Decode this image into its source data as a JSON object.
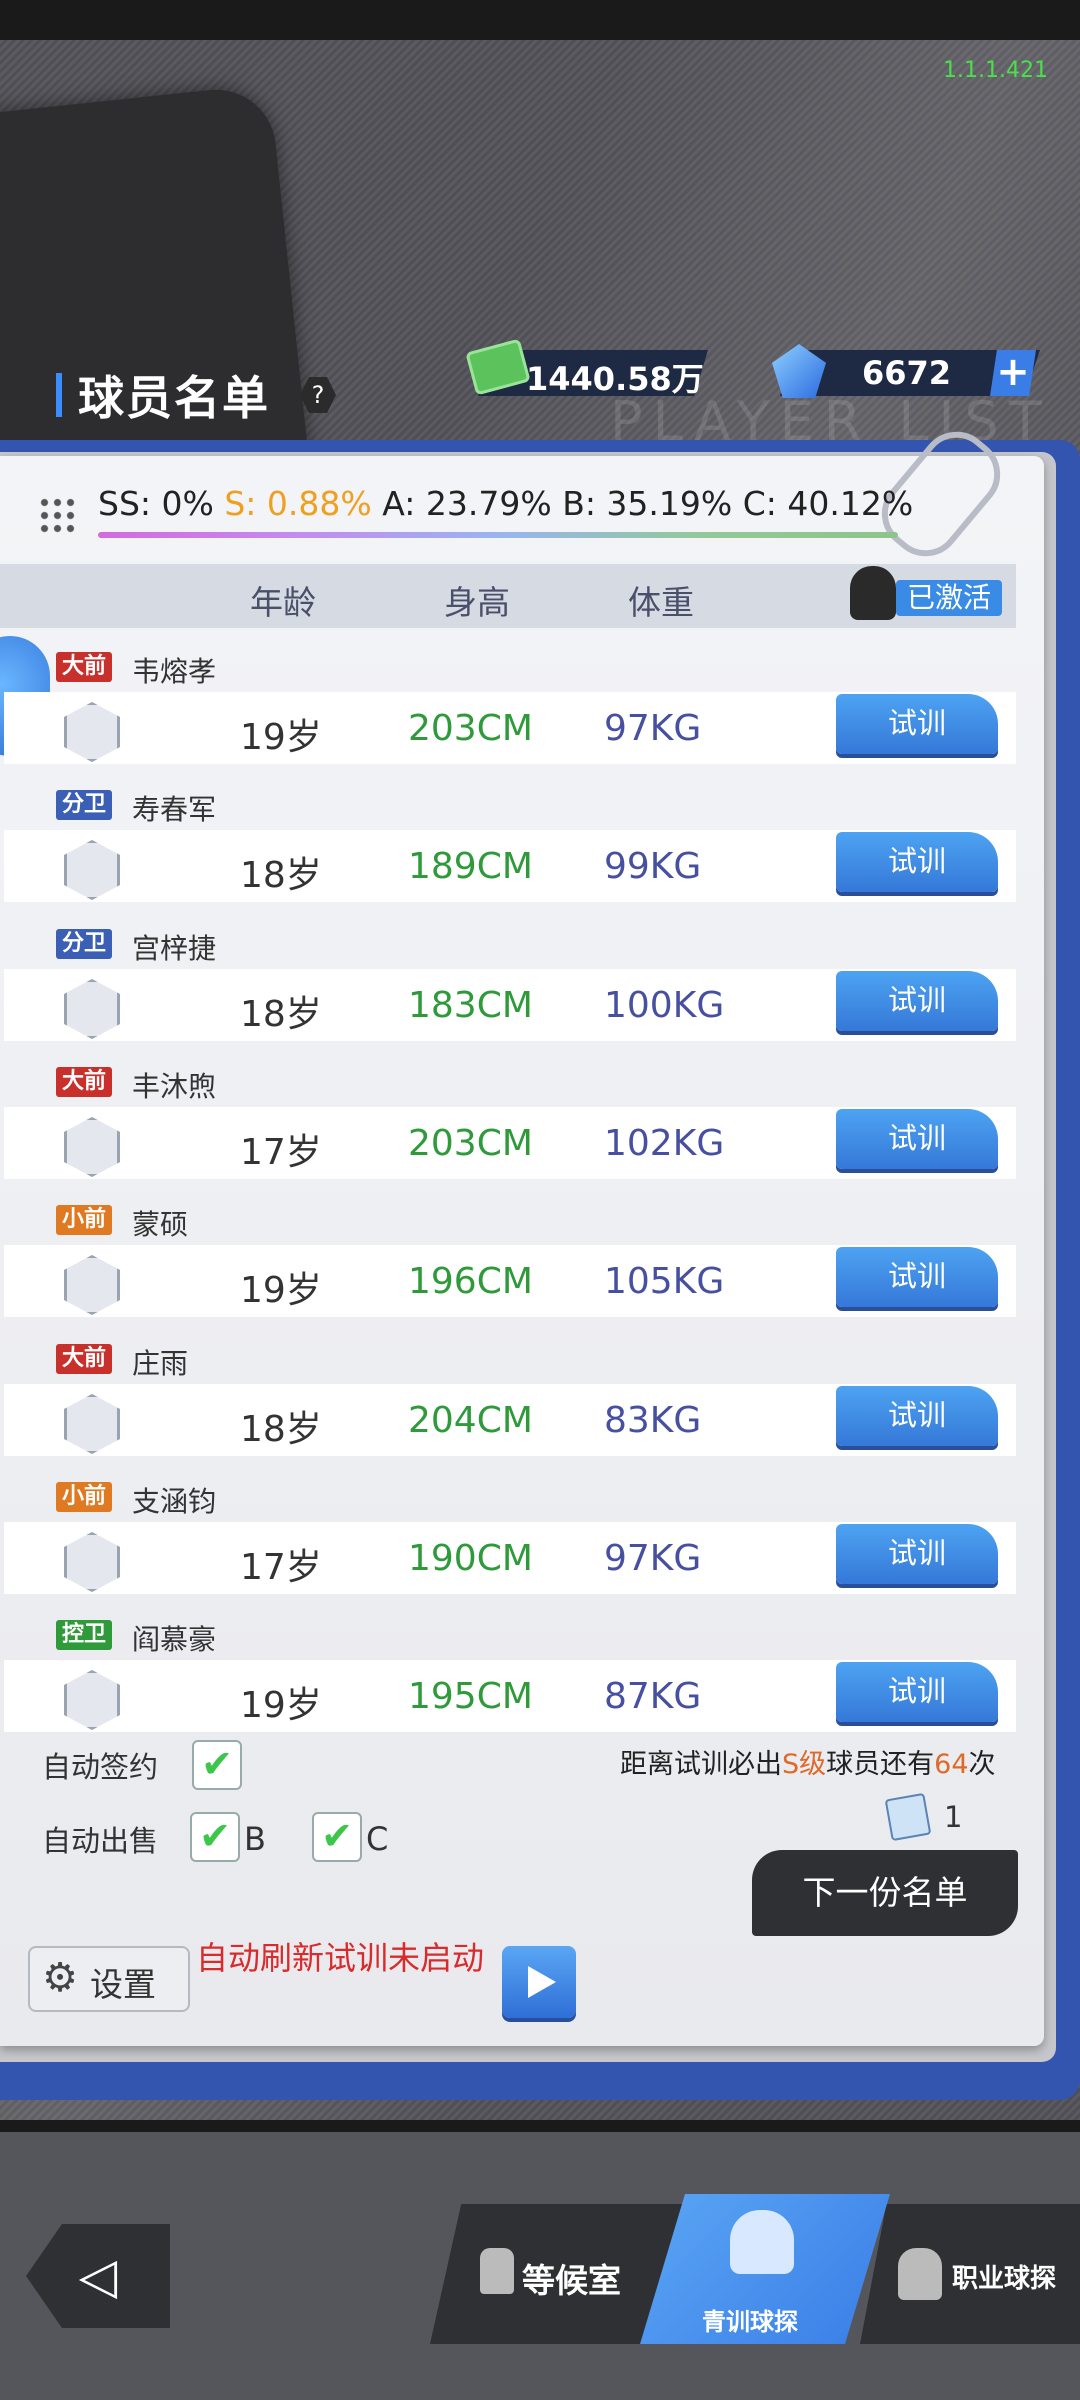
{
  "version": "1.1.1.421",
  "header": {
    "title": "球员名单",
    "help": "?",
    "watermark": "PLAYER LIST",
    "money": "1440.58万",
    "gems": "6672",
    "plus": "+"
  },
  "rates": {
    "ss": "SS: 0%",
    "s": "S: 0.88%",
    "a": "A: 23.79%",
    "b": "B: 35.19%",
    "c": "C: 40.12%"
  },
  "columns": {
    "age": "年龄",
    "height": "身高",
    "weight": "体重",
    "activated": "已激活"
  },
  "players": [
    {
      "pos": "大前",
      "pos_color": "#c8302c",
      "name": "韦熔孝",
      "age": "19岁",
      "height": "203CM",
      "weight": "97KG",
      "action": "试训"
    },
    {
      "pos": "分卫",
      "pos_color": "#3a5fb4",
      "name": "寿春军",
      "age": "18岁",
      "height": "189CM",
      "weight": "99KG",
      "action": "试训"
    },
    {
      "pos": "分卫",
      "pos_color": "#3a5fb4",
      "name": "宫梓捷",
      "age": "18岁",
      "height": "183CM",
      "weight": "100KG",
      "action": "试训"
    },
    {
      "pos": "大前",
      "pos_color": "#c8302c",
      "name": "丰沐煦",
      "age": "17岁",
      "height": "203CM",
      "weight": "102KG",
      "action": "试训"
    },
    {
      "pos": "小前",
      "pos_color": "#e07a22",
      "name": "蒙硕",
      "age": "19岁",
      "height": "196CM",
      "weight": "105KG",
      "action": "试训"
    },
    {
      "pos": "大前",
      "pos_color": "#c8302c",
      "name": "庄雨",
      "age": "18岁",
      "height": "204CM",
      "weight": "83KG",
      "action": "试训"
    },
    {
      "pos": "小前",
      "pos_color": "#e07a22",
      "name": "支涵钧",
      "age": "17岁",
      "height": "190CM",
      "weight": "97KG",
      "action": "试训"
    },
    {
      "pos": "控卫",
      "pos_color": "#2e9a3a",
      "name": "阎慕豪",
      "age": "19岁",
      "height": "195CM",
      "weight": "87KG",
      "action": "试训"
    }
  ],
  "controls": {
    "auto_sign": "自动签约",
    "auto_sell": "自动出售",
    "sell_b": "B",
    "sell_c": "C",
    "check_mark": "✔",
    "s_remain_prefix": "距离试训必出",
    "s_remain_level": "S级",
    "s_remain_mid": "球员还有",
    "s_remain_count": "64",
    "s_remain_suffix": "次",
    "ticket_count": "1",
    "next_list": "下一份名单",
    "settings": "设置",
    "gear": "⚙",
    "auto_refresh": "自动刷新试训未启动"
  },
  "nav": {
    "back": "◁",
    "waiting_room": "等候室",
    "youth_scout": "青训球探",
    "pro_scout": "职业球探"
  }
}
